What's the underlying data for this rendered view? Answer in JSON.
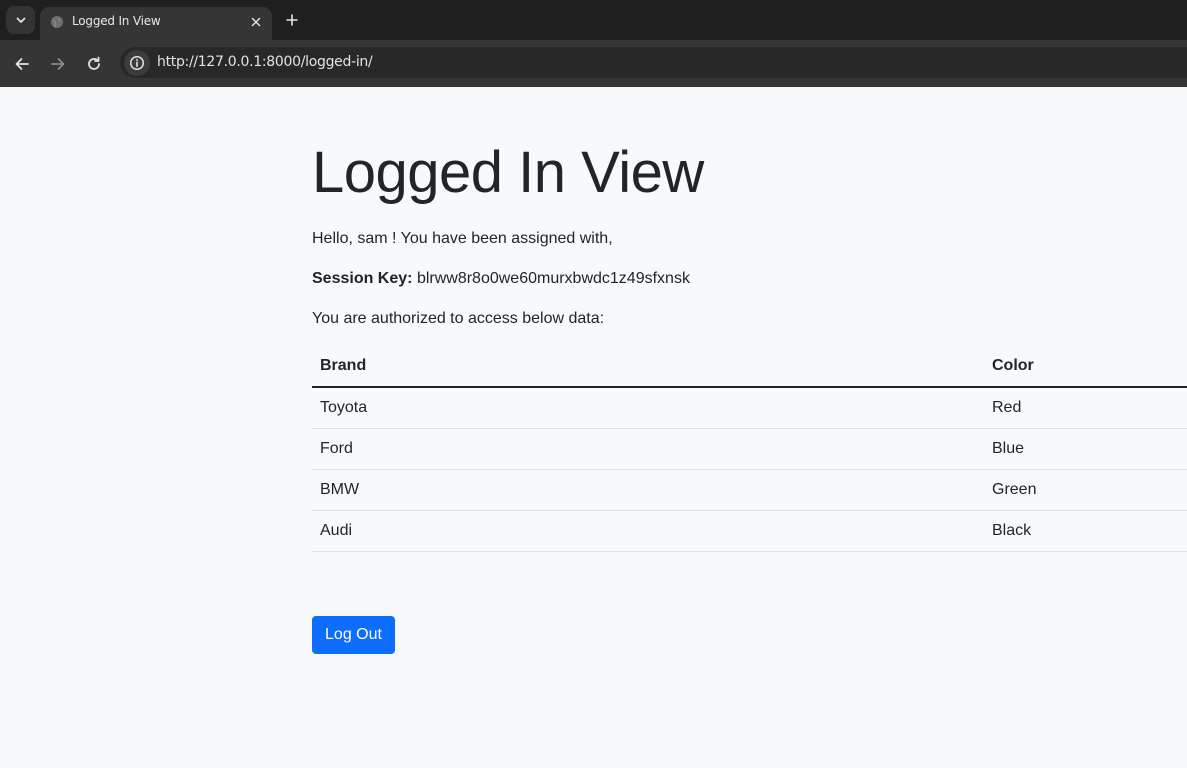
{
  "browser": {
    "tab_title": "Logged In View",
    "url": "http://127.0.0.1:8000/logged-in/"
  },
  "page": {
    "title": "Logged In View",
    "greeting": "Hello, sam ! You have been assigned with,",
    "session_key_label": "Session Key:",
    "session_key_value": "blrww8r8o0we60murxbwdc1z49sfxnsk",
    "authorized_text": "You are authorized to access below data:",
    "table": {
      "headers": [
        "Brand",
        "Color"
      ],
      "rows": [
        [
          "Toyota",
          "Red"
        ],
        [
          "Ford",
          "Blue"
        ],
        [
          "BMW",
          "Green"
        ],
        [
          "Audi",
          "Black"
        ]
      ]
    },
    "logout_label": "Log Out"
  },
  "colors": {
    "primary_button": "#0d6efd",
    "page_background": "#f8f9fa",
    "text": "#212529"
  }
}
